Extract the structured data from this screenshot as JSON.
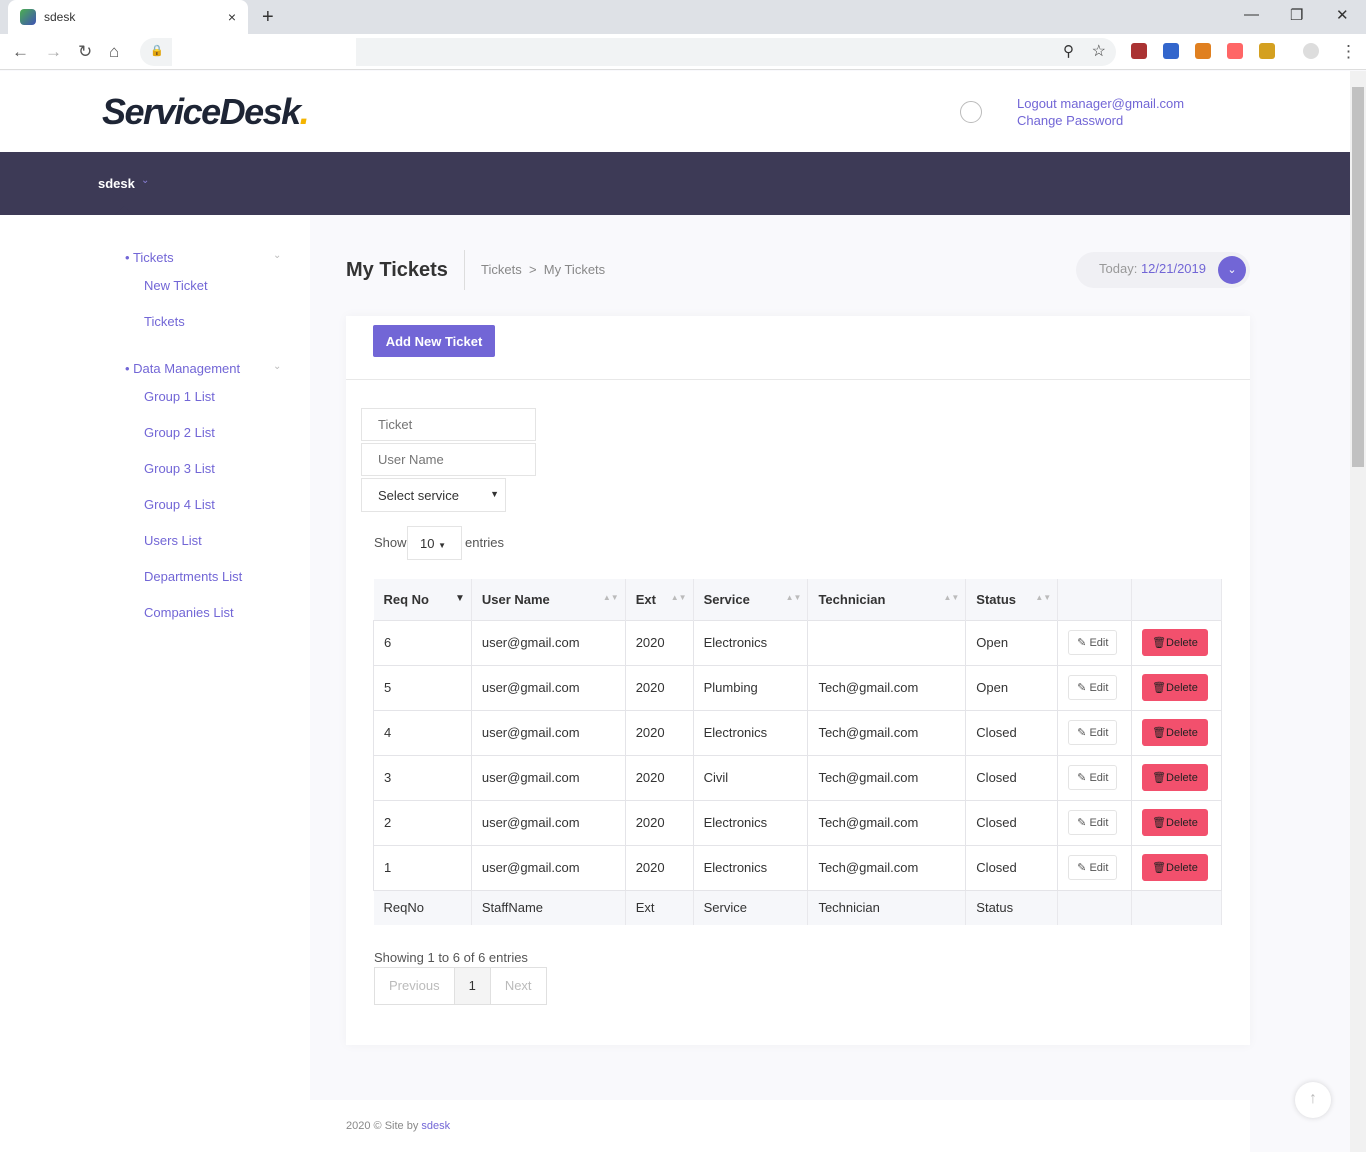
{
  "browser": {
    "tab_title": "sdesk",
    "close": "×",
    "new_tab": "+",
    "win_min": "—",
    "win_max": "❐",
    "win_close": "✕",
    "back": "←",
    "forward": "→",
    "reload": "↻",
    "home": "⌂",
    "lock": "🔒",
    "zoom": "⚲",
    "star": "☆",
    "menu": "⋮"
  },
  "header": {
    "logo": "ServiceDesk",
    "logo_dot": ".",
    "logout": "Logout manager@gmail.com",
    "change_password": "Change Password"
  },
  "navbar": {
    "brand": "sdesk",
    "chevron": "⌄"
  },
  "sidebar": {
    "sections": [
      {
        "label": "Tickets",
        "items": [
          "New Ticket",
          "Tickets"
        ]
      },
      {
        "label": "Data Management",
        "items": [
          "Group 1 List",
          "Group 2 List",
          "Group 3 List",
          "Group 4 List",
          "Users List",
          "Departments List",
          "Companies List"
        ]
      }
    ]
  },
  "page": {
    "title": "My Tickets",
    "breadcrumb": [
      "Tickets",
      ">",
      "My Tickets"
    ],
    "today_label": "Today:",
    "today_value": "12/21/2019"
  },
  "card": {
    "add_button": "Add New Ticket",
    "ticket_placeholder": "Ticket",
    "username_placeholder": "User Name",
    "service_select": "Select service",
    "show": "Show",
    "length": "10",
    "entries": "entries"
  },
  "table": {
    "columns": [
      "Req No",
      "User Name",
      "Ext",
      "Service",
      "Technician",
      "Status",
      "",
      ""
    ],
    "rows": [
      [
        "6",
        "user@gmail.com",
        "2020",
        "Electronics",
        "",
        "Open"
      ],
      [
        "5",
        "user@gmail.com",
        "2020",
        "Plumbing",
        "Tech@gmail.com",
        "Open"
      ],
      [
        "4",
        "user@gmail.com",
        "2020",
        "Electronics",
        "Tech@gmail.com",
        "Closed"
      ],
      [
        "3",
        "user@gmail.com",
        "2020",
        "Civil",
        "Tech@gmail.com",
        "Closed"
      ],
      [
        "2",
        "user@gmail.com",
        "2020",
        "Electronics",
        "Tech@gmail.com",
        "Closed"
      ],
      [
        "1",
        "user@gmail.com",
        "2020",
        "Electronics",
        "Tech@gmail.com",
        "Closed"
      ]
    ],
    "footer": [
      "ReqNo",
      "StaffName",
      "Ext",
      "Service",
      "Technician",
      "Status",
      "",
      ""
    ],
    "edit_label": "Edit",
    "delete_label": "Delete"
  },
  "pagination": {
    "info": "Showing 1 to 6 of 6 entries",
    "previous": "Previous",
    "page": "1",
    "next": "Next"
  },
  "footer": {
    "text": "2020 © Site by",
    "link": "sdesk"
  },
  "colors": {
    "accent": "#7266d6",
    "navbar": "#3d3a56",
    "danger": "#f2506d"
  }
}
